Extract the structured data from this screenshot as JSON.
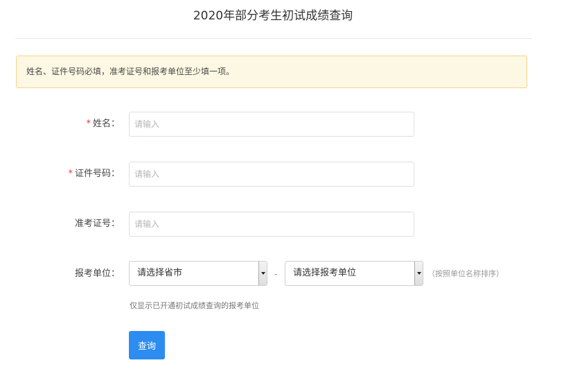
{
  "page": {
    "title": "2020年部分考生初试成绩查询"
  },
  "notice": {
    "text": "姓名、证件号码必填，准考证号和报考单位至少填一项。"
  },
  "form": {
    "required_mark": "*",
    "name": {
      "label": "姓名：",
      "value": "",
      "placeholder": "请输入"
    },
    "id_number": {
      "label": "证件号码：",
      "value": "",
      "placeholder": "请输入"
    },
    "exam_number": {
      "label": "准考证号：",
      "value": "",
      "placeholder": "请输入"
    },
    "unit": {
      "label": "报考单位：",
      "province_select": "请选择省市",
      "separator": "-",
      "unit_select": "请选择报考单位",
      "sort_hint": "（按照单位名称排序）",
      "note": "仅显示已开通初试成绩查询的报考单位"
    },
    "submit_label": "查询"
  },
  "colors": {
    "accent": "#2d8cf0",
    "required": "#e4393c",
    "notice_bg": "#fcf8e3",
    "notice_border": "#fad38a"
  },
  "icons": {
    "select_arrow": "chevron-down-icon"
  }
}
